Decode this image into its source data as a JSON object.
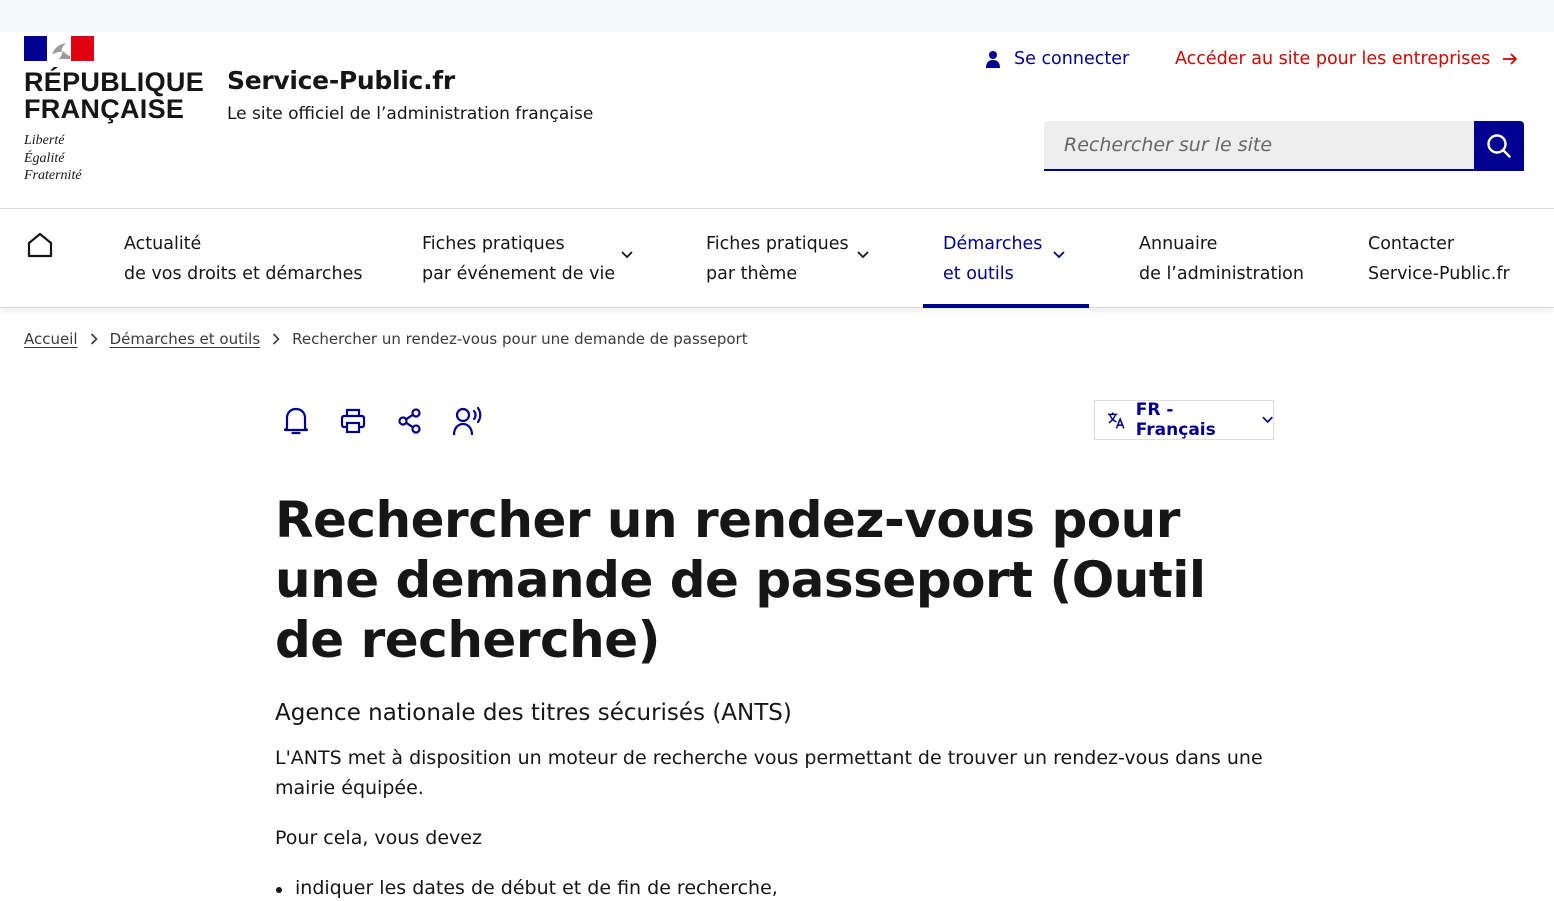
{
  "header": {
    "rf_line1": "RÉPUBLIQUE",
    "rf_line2": "FRANÇAISE",
    "motto": [
      "Liberté",
      "Égalité",
      "Fraternité"
    ],
    "site_name": "Service-Public.fr",
    "site_tagline": "Le site officiel de l’administration française",
    "login_label": "Se connecter",
    "enterprise_link": "Accéder au site pour les entreprises",
    "search_placeholder": "Rechercher sur le site"
  },
  "nav": {
    "items": [
      {
        "line1": "Actualité",
        "line2": "de vos droits et démarches"
      },
      {
        "line1": "Fiches pratiques",
        "line2": "par événement de vie"
      },
      {
        "line1": "Fiches pratiques",
        "line2": "par thème"
      },
      {
        "line1": "Démarches",
        "line2": "et outils"
      },
      {
        "line1": "Annuaire",
        "line2": "de l’administration"
      },
      {
        "line1": "Contacter",
        "line2": "Service-Public.fr"
      }
    ]
  },
  "breadcrumb": {
    "home": "Accueil",
    "section": "Démarches et outils",
    "current": "Rechercher un rendez-vous pour une demande de passeport"
  },
  "tools": {
    "language": "FR - Français",
    "icons": [
      "bell-icon",
      "print-icon",
      "share-icon",
      "listen-icon"
    ]
  },
  "content": {
    "title": "Rechercher un rendez-vous pour une demande de passeport (Outil de recherche)",
    "subtitle": "Agence nationale des titres sécurisés (ANTS)",
    "para1": "L'ANTS met à disposition un moteur de recherche vous permettant de trouver un rendez-vous dans une mairie équipée.",
    "para2": "Pour cela, vous devez",
    "list": [
      "indiquer les dates de début et de fin de recherche,"
    ]
  },
  "colors": {
    "primary": "#000091",
    "accent_red": "#ce0500",
    "text": "#161616"
  }
}
